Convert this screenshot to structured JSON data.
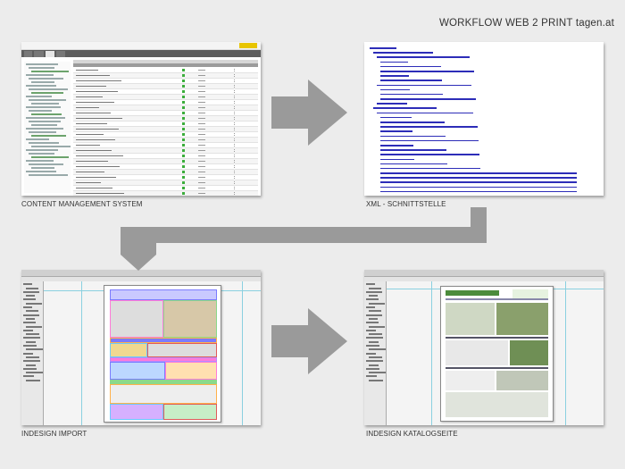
{
  "title": "WORKFLOW WEB 2 PRINT tagen.at",
  "stages": [
    {
      "id": "cms",
      "label": "CONTENT MANAGEMENT SYSTEM"
    },
    {
      "id": "xml",
      "label": "XML - SCHNITTSTELLE"
    },
    {
      "id": "indesign-import",
      "label": "INDESIGN IMPORT"
    },
    {
      "id": "indesign-catalog",
      "label": "INDESIGN KATALOGSEITE"
    }
  ],
  "colors": {
    "arrow": "#9a9a9a",
    "xml_text": "#2d2db8",
    "cms_ok": "#3cad3c",
    "guides": "#8ad0e0"
  }
}
